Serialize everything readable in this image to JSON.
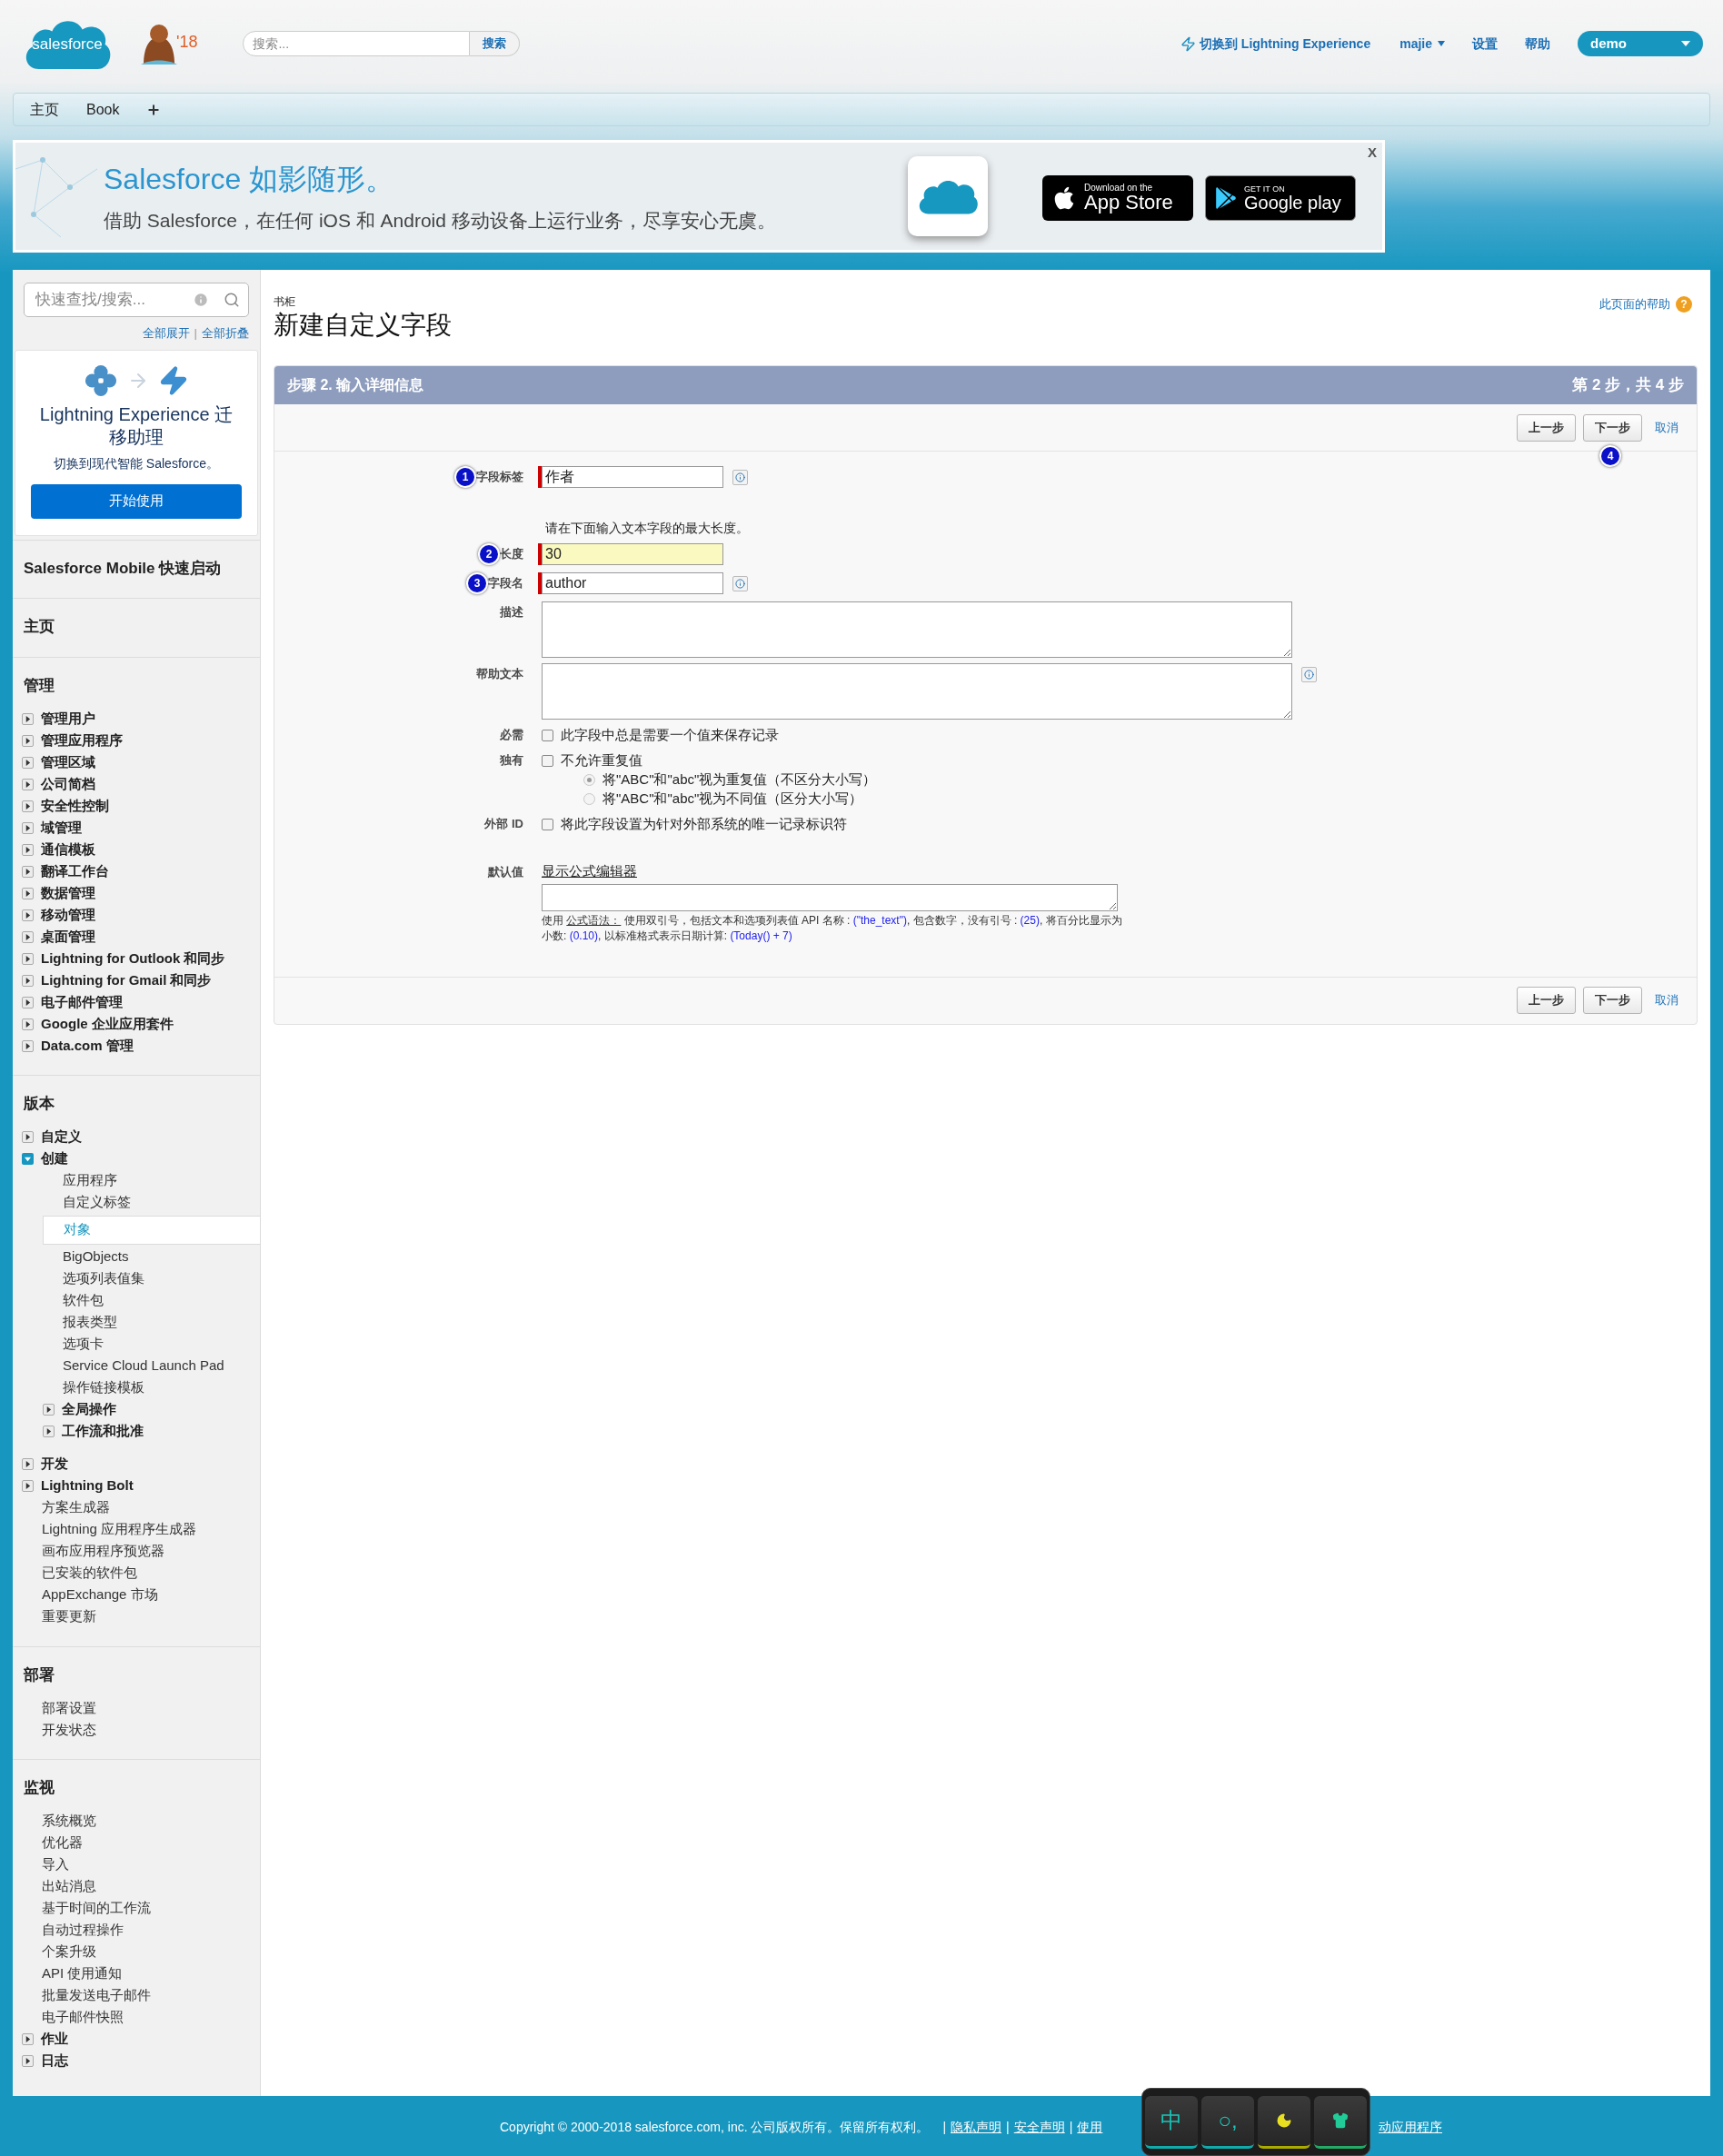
{
  "header": {
    "logo": "salesforce",
    "badge": "'18",
    "search": {
      "placeholder": "搜索...",
      "button": "搜索"
    },
    "lightning_link": "切换到 Lightning Experience",
    "user": "majie",
    "links": [
      "设置",
      "帮助"
    ],
    "app_menu": "demo"
  },
  "tabs": [
    {
      "label": "主页"
    },
    {
      "label": "Book"
    }
  ],
  "banner": {
    "title": "Salesforce 如影随形。",
    "text": "借助 Salesforce，在任何 iOS 和 Android 移动设备上运行业务，尽享安心无虞。",
    "app_store": {
      "small": "Download on the",
      "big": "App Store"
    },
    "google_play": {
      "small": "GET IT ON",
      "big": "Google play"
    },
    "close": "X"
  },
  "sidebar": {
    "search": {
      "placeholder": "快速查找/搜索..."
    },
    "expand_all": "全部展开",
    "separator": "|",
    "collapse_all": "全部折叠",
    "migration": {
      "title": "Lightning Experience 迁移助理",
      "subtitle": "切换到现代智能 Salesforce。",
      "button": "开始使用"
    },
    "sections": [
      {
        "title": "Salesforce Mobile 快速启动"
      },
      {
        "title": "主页"
      },
      {
        "title": "管理",
        "items": [
          {
            "kind": "folder",
            "label": "管理用户",
            "expanded": false
          },
          {
            "kind": "folder",
            "label": "管理应用程序",
            "expanded": false
          },
          {
            "kind": "folder",
            "label": "管理区域",
            "expanded": false
          },
          {
            "kind": "folder",
            "label": "公司简档",
            "expanded": false
          },
          {
            "kind": "folder",
            "label": "安全性控制",
            "expanded": false
          },
          {
            "kind": "folder",
            "label": "域管理",
            "expanded": false
          },
          {
            "kind": "folder",
            "label": "通信模板",
            "expanded": false
          },
          {
            "kind": "folder",
            "label": "翻译工作台",
            "expanded": false
          },
          {
            "kind": "folder",
            "label": "数据管理",
            "expanded": false
          },
          {
            "kind": "folder",
            "label": "移动管理",
            "expanded": false
          },
          {
            "kind": "folder",
            "label": "桌面管理",
            "expanded": false
          },
          {
            "kind": "folder",
            "label": "Lightning for Outlook 和同步",
            "expanded": false
          },
          {
            "kind": "folder",
            "label": "Lightning for Gmail 和同步",
            "expanded": false
          },
          {
            "kind": "folder",
            "label": "电子邮件管理",
            "expanded": false
          },
          {
            "kind": "folder",
            "label": "Google 企业应用套件",
            "expanded": false
          },
          {
            "kind": "folder",
            "label": "Data.com 管理",
            "expanded": false
          }
        ]
      },
      {
        "title": "版本",
        "items": [
          {
            "kind": "folder",
            "label": "自定义",
            "expanded": false
          },
          {
            "kind": "folder",
            "label": "创建",
            "expanded": true,
            "children": [
              {
                "kind": "link",
                "label": "应用程序",
                "selected": false
              },
              {
                "kind": "link",
                "label": "自定义标签",
                "selected": false
              },
              {
                "kind": "link",
                "label": "对象",
                "selected": true
              },
              {
                "kind": "link",
                "label": "BigObjects",
                "selected": false
              },
              {
                "kind": "link",
                "label": "选项列表值集",
                "selected": false
              },
              {
                "kind": "link",
                "label": "软件包",
                "selected": false
              },
              {
                "kind": "link",
                "label": "报表类型",
                "selected": false
              },
              {
                "kind": "link",
                "label": "选项卡",
                "selected": false
              },
              {
                "kind": "link",
                "label": "Service Cloud Launch Pad",
                "selected": false
              },
              {
                "kind": "link",
                "label": "操作链接模板",
                "selected": false
              },
              {
                "kind": "folder",
                "label": "全局操作",
                "expanded": false
              },
              {
                "kind": "folder",
                "label": "工作流和批准",
                "expanded": false
              }
            ]
          },
          {
            "kind": "gap"
          },
          {
            "kind": "folder",
            "label": "开发",
            "expanded": false
          },
          {
            "kind": "folder",
            "label": "Lightning Bolt",
            "expanded": false
          },
          {
            "kind": "link",
            "label": "方案生成器",
            "selected": false
          },
          {
            "kind": "link",
            "label": "Lightning 应用程序生成器",
            "selected": false
          },
          {
            "kind": "link",
            "label": "画布应用程序预览器",
            "selected": false
          },
          {
            "kind": "link",
            "label": "已安装的软件包",
            "selected": false
          },
          {
            "kind": "link",
            "label": "AppExchange 市场",
            "selected": false
          },
          {
            "kind": "link",
            "label": "重要更新",
            "selected": false
          }
        ]
      },
      {
        "title": "部署",
        "items": [
          {
            "kind": "link",
            "label": "部署设置",
            "selected": false
          },
          {
            "kind": "link",
            "label": "开发状态",
            "selected": false
          }
        ]
      },
      {
        "title": "监视",
        "items": [
          {
            "kind": "link",
            "label": "系统概览",
            "selected": false
          },
          {
            "kind": "link",
            "label": "优化器",
            "selected": false
          },
          {
            "kind": "link",
            "label": "导入",
            "selected": false
          },
          {
            "kind": "link",
            "label": "出站消息",
            "selected": false
          },
          {
            "kind": "link",
            "label": "基于时间的工作流",
            "selected": false
          },
          {
            "kind": "link",
            "label": "自动过程操作",
            "selected": false
          },
          {
            "kind": "link",
            "label": "个案升级",
            "selected": false
          },
          {
            "kind": "link",
            "label": "API 使用通知",
            "selected": false
          },
          {
            "kind": "link",
            "label": "批量发送电子邮件",
            "selected": false
          },
          {
            "kind": "link",
            "label": "电子邮件快照",
            "selected": false
          },
          {
            "kind": "folder",
            "label": "作业",
            "expanded": false
          },
          {
            "kind": "folder",
            "label": "日志",
            "expanded": false
          }
        ]
      }
    ]
  },
  "page": {
    "breadcrumb": "书柜",
    "title": "新建自定义字段",
    "help": "此页面的帮助",
    "help_icon": "?"
  },
  "step": {
    "title": "步骤 2. 输入详细信息",
    "counter": "第 2 步，共 4 步",
    "next_badge": "4",
    "top_actions": {
      "buttons": [
        "上一步",
        "下一步"
      ],
      "cancel": "取消"
    },
    "bottom_actions": {
      "buttons": [
        "上一步",
        "下一步"
      ],
      "cancel": "取消"
    }
  },
  "form": {
    "fields": [
      {
        "kind": "text",
        "label": "字段标签",
        "badge": "1",
        "value": "作者",
        "required": true,
        "info": true,
        "highlighted": false
      },
      {
        "kind": "note",
        "text": "请在下面输入文本字段的最大长度。"
      },
      {
        "kind": "text",
        "label": "长度",
        "badge": "2",
        "value": "30",
        "required": true,
        "info": false,
        "highlighted": true
      },
      {
        "kind": "text",
        "label": "字段名",
        "badge": "3",
        "value": "author",
        "required": true,
        "info": true,
        "highlighted": false
      },
      {
        "kind": "textarea",
        "label": "描述",
        "info": false
      },
      {
        "kind": "textarea",
        "label": "帮助文本",
        "info": true
      },
      {
        "kind": "checkbox",
        "label": "必需",
        "text": "此字段中总是需要一个值来保存记录",
        "checked": false
      },
      {
        "kind": "checkbox",
        "label": "独有",
        "text": "不允许重复值",
        "checked": false,
        "options": [
          {
            "label": "将\"ABC\"和\"abc\"视为重复值（不区分大小写）",
            "selected": true
          },
          {
            "label": "将\"ABC\"和\"abc\"视为不同值（区分大小写）",
            "selected": false
          }
        ]
      },
      {
        "kind": "checkbox",
        "label": "外部 ID",
        "text": "将此字段设置为针对外部系统的唯一记录标识符",
        "checked": false
      },
      {
        "kind": "formula",
        "label": "默认值",
        "link": "显示公式编辑器",
        "hint": [
          {
            "kind": "plain",
            "text": "使用 "
          },
          {
            "kind": "link",
            "text": "公式语法："
          },
          {
            "kind": "plain",
            "text": " 使用双引号，包括文本和选项列表值 API 名称 : "
          },
          {
            "kind": "code",
            "text": "(\"the_text\")"
          },
          {
            "kind": "plain",
            "text": ", 包含数字，没有引号 : "
          },
          {
            "kind": "code",
            "text": "(25)"
          },
          {
            "kind": "plain",
            "text": ", 将百分比显示为小数: "
          },
          {
            "kind": "code",
            "text": "(0.10)"
          },
          {
            "kind": "plain",
            "text": ", 以标准格式表示日期计算: "
          },
          {
            "kind": "code",
            "text": "(Today() + 7)"
          }
        ]
      }
    ]
  },
  "footer": {
    "copyright": "Copyright © 2000-2018 salesforce.com, inc. 公司版权所有。保留所有权利。",
    "links": [
      {
        "separator": "|",
        "label": "隐私声明"
      },
      {
        "separator": "|",
        "label": "安全声明"
      },
      {
        "separator": "|",
        "label": "使用"
      }
    ],
    "trailing": "动应用程序"
  },
  "ime_toolbar": {
    "keys": [
      {
        "kind": "text",
        "label": "中"
      },
      {
        "kind": "text",
        "label": "○,"
      },
      {
        "kind": "moon"
      },
      {
        "kind": "shirt"
      }
    ]
  }
}
